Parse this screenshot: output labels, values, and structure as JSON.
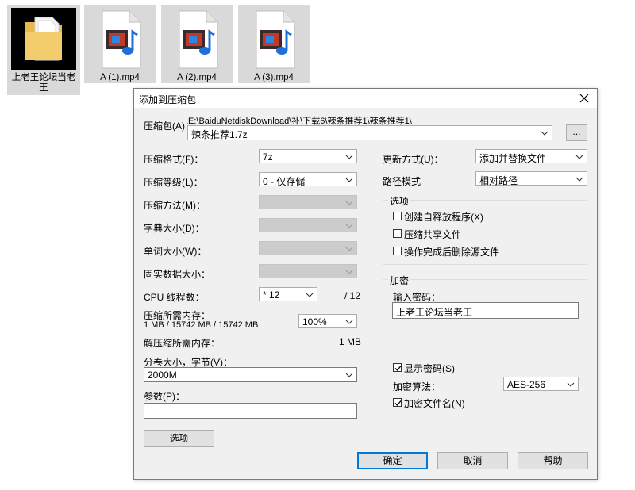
{
  "desktop": {
    "files": [
      {
        "name": "上老王论坛当老王",
        "type": "folder"
      },
      {
        "name": "A (1).mp4",
        "type": "video"
      },
      {
        "name": "A (2).mp4",
        "type": "video"
      },
      {
        "name": "A (3).mp4",
        "type": "video"
      }
    ]
  },
  "dialog": {
    "title": "添加到压缩包",
    "archive_label": "压缩包(A)：",
    "archive_path": "E:\\BaiduNetdiskDownload\\补\\下载6\\辣条推荐1\\辣条推荐1\\",
    "archive_name": "辣条推荐1.7z",
    "browse_label": "...",
    "left": {
      "format_label": "压缩格式(F)：",
      "format_value": "7z",
      "level_label": "压缩等级(L)：",
      "level_value": "0 - 仅存储",
      "method_label": "压缩方法(M)：",
      "dict_label": "字典大小(D)：",
      "word_label": "单词大小(W)：",
      "solid_label": "固实数据大小：",
      "cpu_label": "CPU 线程数：",
      "cpu_value": "* 12",
      "cpu_total": "/ 12",
      "mem_comp_label": "压缩所需内存：",
      "mem_comp_value": "1 MB / 15742 MB / 15742 MB",
      "mem_percent": "100%",
      "mem_decomp_label": "解压缩所需内存：",
      "mem_decomp_value": "1 MB",
      "split_label": "分卷大小，字节(V)：",
      "split_value": "2000M",
      "params_label": "参数(P)：",
      "params_value": "",
      "options_button": "选项"
    },
    "right": {
      "update_label": "更新方式(U)：",
      "update_value": "添加并替换文件",
      "path_label": "路径模式",
      "path_value": "相对路径",
      "options_group": "选项",
      "opt_sfx": "创建自释放程序(X)",
      "opt_sfx_checked": false,
      "opt_shared": "压缩共享文件",
      "opt_shared_checked": false,
      "opt_delete": "操作完成后删除源文件",
      "opt_delete_checked": false,
      "encrypt_group": "加密",
      "password_label": "输入密码：",
      "password_value": "上老王论坛当老王",
      "show_password": "显示密码(S)",
      "show_password_checked": true,
      "method_label": "加密算法：",
      "method_value": "AES-256",
      "encrypt_names": "加密文件名(N)",
      "encrypt_names_checked": true
    },
    "buttons": {
      "ok": "确定",
      "cancel": "取消",
      "help": "帮助"
    }
  }
}
